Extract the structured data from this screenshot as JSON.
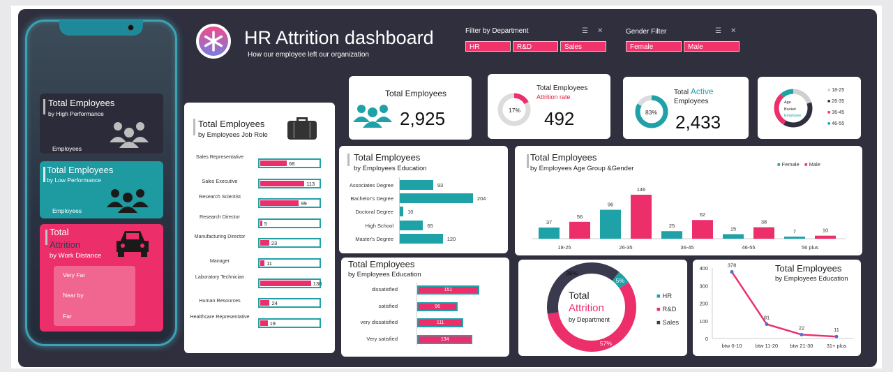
{
  "header": {
    "title": "HR Attrition dashboard",
    "subtitle": "How our employee left our organization",
    "logo_icon": "asterisk-logo-icon"
  },
  "filters": {
    "department": {
      "label": "Filter by Department",
      "options": [
        "HR",
        "R&D",
        "Sales"
      ]
    },
    "gender": {
      "label": "Gender Filter",
      "options": [
        "Female",
        "Male"
      ]
    }
  },
  "phone": {
    "high_perf": {
      "title": "Total Employees",
      "subtitle": "by High Performance",
      "footer": "Employees"
    },
    "low_perf": {
      "title": "Total Employees",
      "subtitle": "by Low Performance",
      "footer": "Employees"
    },
    "attrition": {
      "title1": "Total",
      "title2": "Attrition",
      "subtitle": "by Work Distance",
      "items": [
        "Very Far",
        "Near by",
        "Far"
      ]
    }
  },
  "kpi": {
    "total": {
      "label": "Total Employees",
      "value": "2,925"
    },
    "attrition": {
      "label": "Total Employees",
      "sublabel": "Attrition rate",
      "percent": "17%",
      "value": "492",
      "fraction": 0.17
    },
    "active": {
      "label1": "Total",
      "label_accent": "Active",
      "label2": "Employees",
      "percent": "83%",
      "value": "2,433",
      "fraction": 0.83
    },
    "age_bucket": {
      "center1": "Age",
      "center2": "Bucket",
      "center3": "Employee",
      "legend": [
        "18-25",
        "26-35",
        "36-45",
        "46-55"
      ]
    }
  },
  "job_role": {
    "title": "Total Employees",
    "subtitle": "by Employees Job Role",
    "items": [
      {
        "label": "Sales Representative",
        "value": 68
      },
      {
        "label": "Sales Executive",
        "value": 113
      },
      {
        "label": "Research Scientist",
        "value": 99
      },
      {
        "label": "Research Director",
        "value": 5
      },
      {
        "label": "Manufacturing Director",
        "value": 23
      },
      {
        "label": "Manager",
        "value": 11
      },
      {
        "label": "Laboratory Technician",
        "value": 130
      },
      {
        "label": "Human Resources",
        "value": 24
      },
      {
        "label": "Healthcare Representative",
        "value": 19
      }
    ]
  },
  "education": {
    "title": "Total Employees",
    "subtitle": "by Employees Education",
    "items": [
      {
        "label": "Associates Degree",
        "value": 93
      },
      {
        "label": "Bachelor's Degree",
        "value": 204
      },
      {
        "label": "Doctoral Degree",
        "value": 10
      },
      {
        "label": "High School",
        "value": 65
      },
      {
        "label": "Master's Degree",
        "value": 120
      }
    ]
  },
  "satisfaction": {
    "title": "Total Employees",
    "subtitle": "by Employees Education",
    "items": [
      {
        "label": "dissatisfied",
        "value": 151
      },
      {
        "label": "satisfied",
        "value": 96
      },
      {
        "label": "very dissatisfied",
        "value": 111
      },
      {
        "label": "Very satisfied",
        "value": 134
      }
    ]
  },
  "age_gender": {
    "title": "Total Employees",
    "subtitle": "by Employees Age Group &Gender",
    "legend": [
      "Female",
      "Male"
    ],
    "categories": [
      "18-25",
      "26-35",
      "36-45",
      "46-55",
      "56 plus"
    ],
    "female": [
      37,
      96,
      25,
      15,
      7
    ],
    "male": [
      56,
      146,
      62,
      38,
      10
    ]
  },
  "department": {
    "title1": "Total",
    "title2": "Attrition",
    "title3": "by Department",
    "legend": [
      "HR",
      "R&D",
      "Sales"
    ],
    "percents": [
      "5%",
      "57%",
      "38%"
    ],
    "fractions": [
      0.05,
      0.57,
      0.38
    ]
  },
  "line_chart": {
    "title": "Total Employees",
    "subtitle": "by Employees Education",
    "categories": [
      "btw 0-10",
      "btw 11-20",
      "btw 21-30",
      "31+ plus"
    ],
    "values": [
      378,
      81,
      22,
      11
    ],
    "yticks": [
      "400",
      "300",
      "200",
      "100",
      "0"
    ]
  },
  "colors": {
    "pink": "#ec2f6b",
    "teal": "#1ea2a8",
    "dark": "#2f2f3e",
    "navy": "#3a3a4e"
  },
  "chart_data": [
    {
      "type": "bar",
      "title": "Total Employees",
      "subtitle": "by Employees Job Role",
      "categories": [
        "Sales Representative",
        "Sales Executive",
        "Research Scientist",
        "Research Director",
        "Manufacturing Director",
        "Manager",
        "Laboratory Technician",
        "Human Resources",
        "Healthcare Representative"
      ],
      "values": [
        68,
        113,
        99,
        5,
        23,
        11,
        130,
        24,
        19
      ]
    },
    {
      "type": "bar",
      "title": "Total Employees",
      "subtitle": "by Employees Education",
      "categories": [
        "Associates Degree",
        "Bachelor's Degree",
        "Doctoral Degree",
        "High School",
        "Master's Degree"
      ],
      "values": [
        93,
        204,
        10,
        65,
        120
      ]
    },
    {
      "type": "bar",
      "title": "Total Employees",
      "subtitle": "by Employees Age Group &Gender",
      "categories": [
        "18-25",
        "26-35",
        "36-45",
        "46-55",
        "56 plus"
      ],
      "series": [
        {
          "name": "Female",
          "values": [
            37,
            96,
            25,
            15,
            7
          ]
        },
        {
          "name": "Male",
          "values": [
            56,
            146,
            62,
            38,
            10
          ]
        }
      ],
      "legend": "top-right"
    },
    {
      "type": "bar",
      "title": "Total Employees",
      "subtitle": "by Employees Education",
      "categories": [
        "dissatisfied",
        "satisfied",
        "very dissatisfied",
        "Very satisfied"
      ],
      "values": [
        151,
        96,
        111,
        134
      ]
    },
    {
      "type": "pie",
      "title": "Total Attrition by Department",
      "categories": [
        "HR",
        "R&D",
        "Sales"
      ],
      "values": [
        5,
        57,
        38
      ]
    },
    {
      "type": "line",
      "title": "Total Employees",
      "subtitle": "by Employees Education",
      "x": [
        "btw 0-10",
        "btw 11-20",
        "btw 21-30",
        "31+ plus"
      ],
      "values": [
        378,
        81,
        22,
        11
      ],
      "ylim": [
        0,
        400
      ]
    }
  ]
}
